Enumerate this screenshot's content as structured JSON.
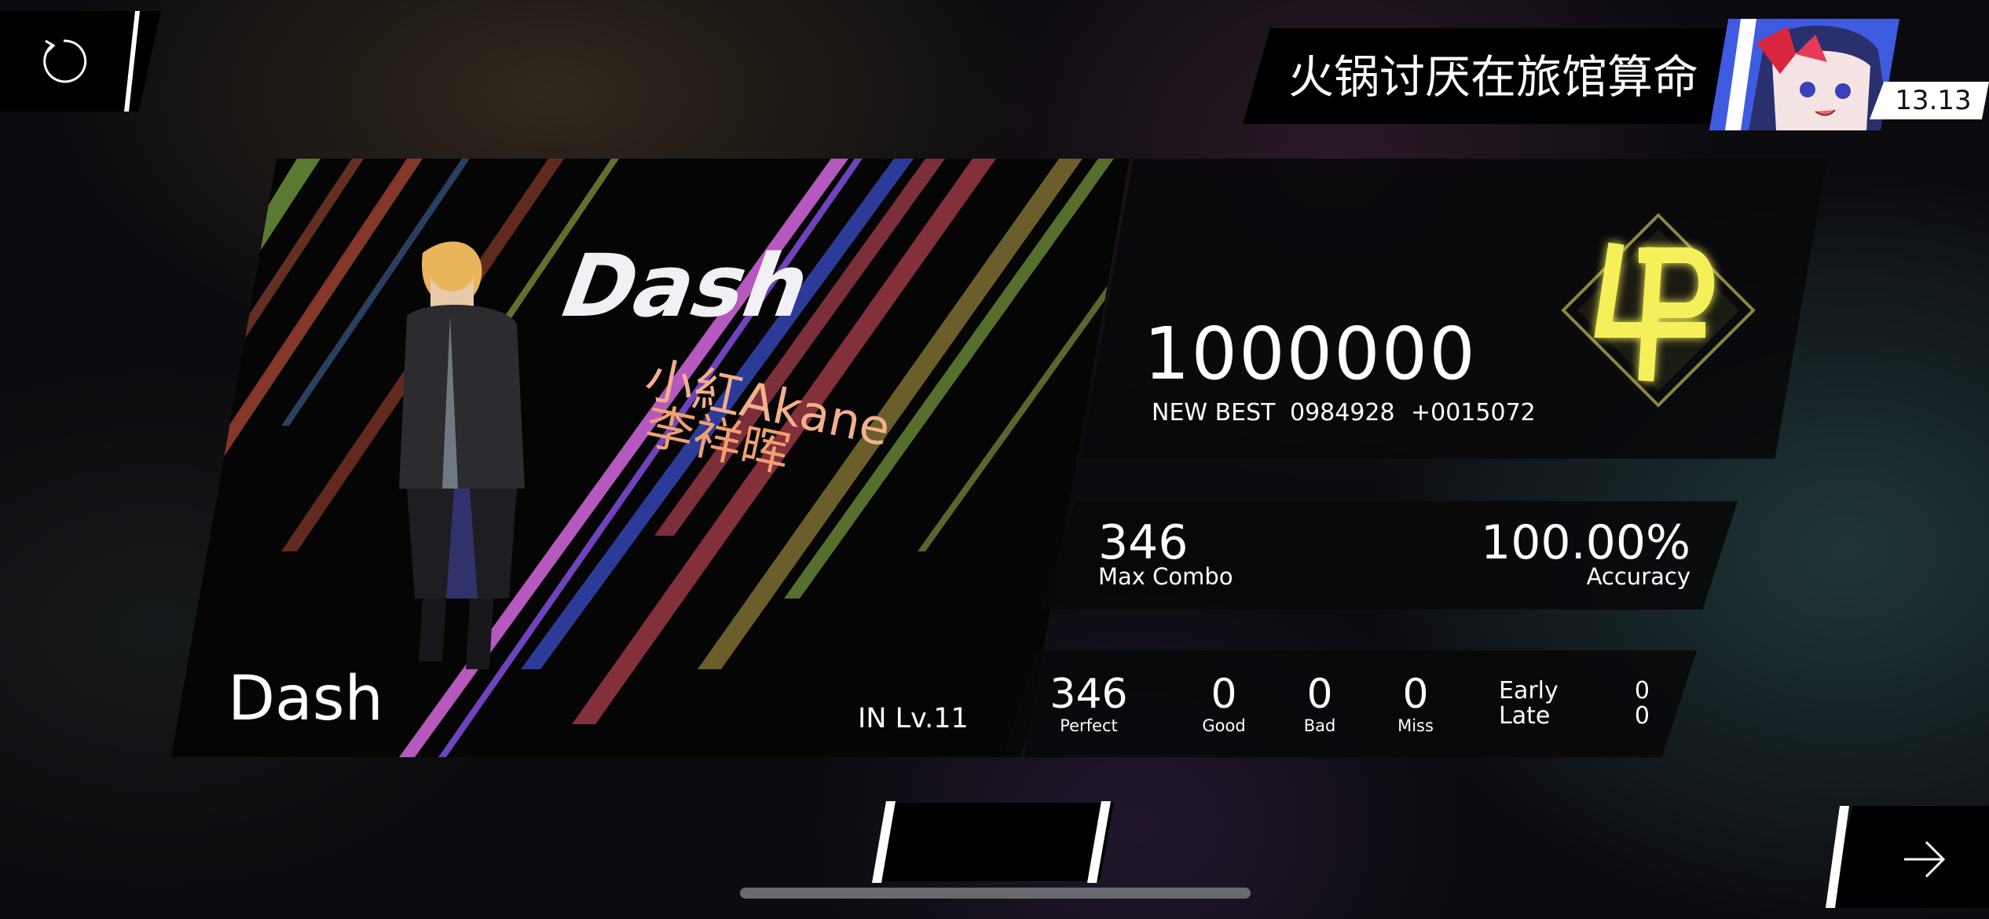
{
  "player": {
    "name": "火锅讨厌在旅馆算命",
    "rks": "13.13"
  },
  "song": {
    "title": "Dash",
    "difficulty_label": "IN  Lv.11",
    "art_title": "Dash",
    "art_line1": "小紅Akane",
    "art_line2": "李祥晖"
  },
  "score": {
    "value": "1000000",
    "new_best_label": "NEW BEST",
    "previous_best": "0984928",
    "difference": "+0015072",
    "rank": "φ"
  },
  "stats": {
    "max_combo": "346",
    "max_combo_label": "Max Combo",
    "accuracy": "100.00%",
    "accuracy_label": "Accuracy"
  },
  "judgements": {
    "perfect": "346",
    "perfect_label": "Perfect",
    "good": "0",
    "good_label": "Good",
    "bad": "0",
    "bad_label": "Bad",
    "miss": "0",
    "miss_label": "Miss",
    "early_label": "Early",
    "early": "0",
    "late_label": "Late",
    "late": "0"
  },
  "icons": {
    "retry": "retry-icon",
    "next": "arrow-right-icon"
  },
  "colors": {
    "rank_glow": "#f4f05a",
    "panel": "#08080a",
    "avatar_bg": "#3a56d6"
  }
}
